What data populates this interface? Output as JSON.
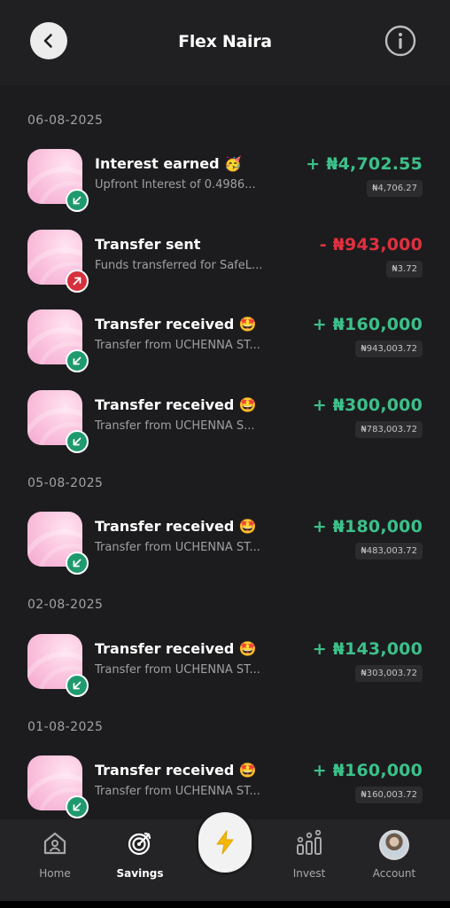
{
  "header": {
    "title": "Flex Naira",
    "back_icon": "chevron-left-icon",
    "info_icon": "info-circle-icon"
  },
  "colors": {
    "background": "#1c1c1e",
    "credit": "#3cc08a",
    "debit": "#e0303f",
    "badge_in": "#1f9a6e",
    "badge_out": "#d6303d"
  },
  "groups": [
    {
      "date": "06-08-2025",
      "transactions": [
        {
          "title": "Interest earned 🥳",
          "subtitle": "Upfront Interest of 0.4986...",
          "amount": "+ ₦4,702.55",
          "balance": "₦4,706.27",
          "direction": "in"
        },
        {
          "title": "Transfer sent",
          "subtitle": "Funds transferred for SafeL...",
          "amount": "- ₦943,000",
          "balance": "₦3.72",
          "direction": "out"
        },
        {
          "title": "Transfer received 🤩",
          "subtitle": "Transfer from UCHENNA ST...",
          "amount": "+ ₦160,000",
          "balance": "₦943,003.72",
          "direction": "in"
        },
        {
          "title": "Transfer received 🤩",
          "subtitle": "Transfer from UCHENNA S...",
          "amount": "+ ₦300,000",
          "balance": "₦783,003.72",
          "direction": "in"
        }
      ]
    },
    {
      "date": "05-08-2025",
      "transactions": [
        {
          "title": "Transfer received 🤩",
          "subtitle": "Transfer from UCHENNA ST...",
          "amount": "+ ₦180,000",
          "balance": "₦483,003.72",
          "direction": "in"
        }
      ]
    },
    {
      "date": "02-08-2025",
      "transactions": [
        {
          "title": "Transfer received 🤩",
          "subtitle": "Transfer from UCHENNA ST...",
          "amount": "+ ₦143,000",
          "balance": "₦303,003.72",
          "direction": "in"
        }
      ]
    },
    {
      "date": "01-08-2025",
      "transactions": [
        {
          "title": "Transfer received 🤩",
          "subtitle": "Transfer from UCHENNA ST...",
          "amount": "+ ₦160,000",
          "balance": "₦160,003.72",
          "direction": "in"
        }
      ]
    }
  ],
  "nav": {
    "home": "Home",
    "savings": "Savings",
    "invest": "Invest",
    "account": "Account",
    "active": "savings",
    "center_icon": "lightning-icon"
  }
}
